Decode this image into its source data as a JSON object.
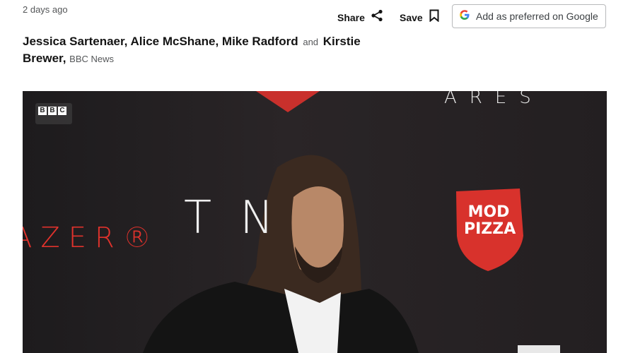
{
  "article": {
    "timestamp": "2 days ago",
    "byline": {
      "authors_primary": "Jessica Sartenaer, Alice McShane, Mike Radford",
      "conjunction": "and",
      "author_last": "Kirstie Brewer,",
      "organisation": "BBC News"
    }
  },
  "actions": {
    "share_label": "Share",
    "save_label": "Save",
    "google_label": "Add as preferred on Google",
    "icons": {
      "share": "share-icon",
      "save": "bookmark-icon",
      "google": "google-g-icon"
    }
  },
  "media": {
    "badge_letters": [
      "B",
      "B",
      "C"
    ],
    "backdrop_texts": {
      "ares": "ARES",
      "razer": "AZER®",
      "ton": "TN",
      "mod_line1": "MOD",
      "mod_line2": "PIZZA"
    }
  }
}
